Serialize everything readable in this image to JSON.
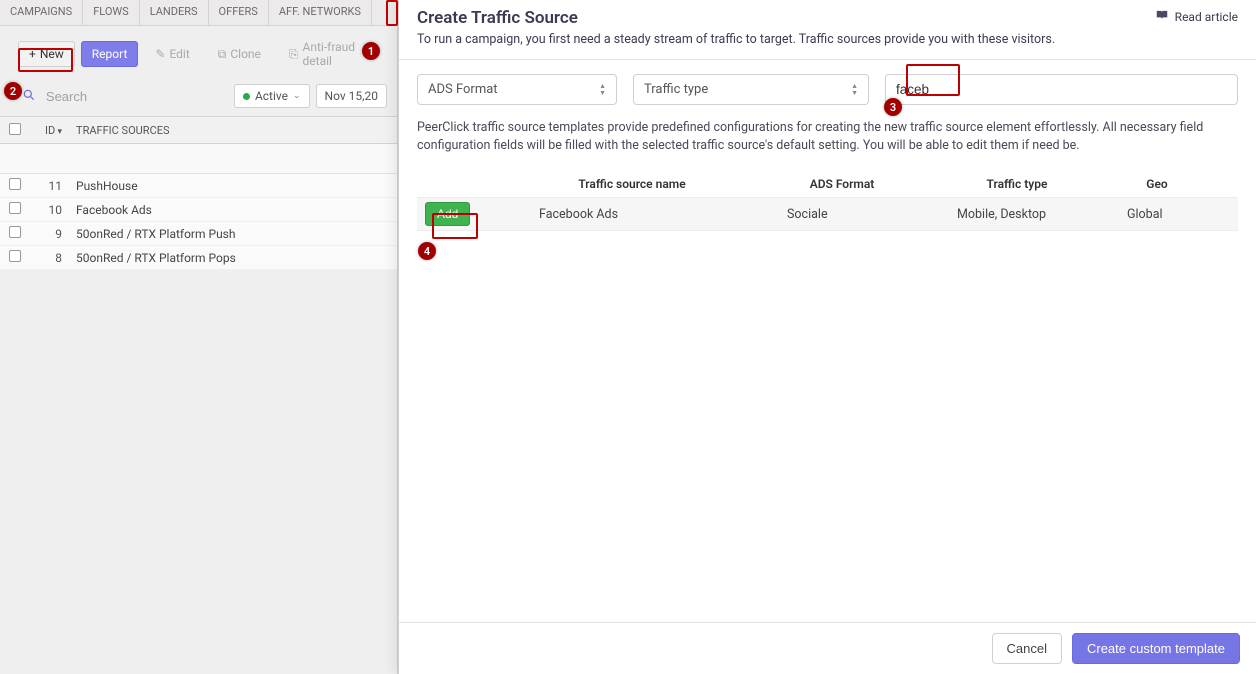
{
  "tabs": {
    "campaigns": "CAMPAIGNS",
    "flows": "FLOWS",
    "landers": "LANDERS",
    "offers": "OFFERS",
    "networks": "AFF. NETWORKS"
  },
  "toolbar": {
    "new_label": "New",
    "report_label": "Report",
    "edit_label": "Edit",
    "clone_label": "Clone",
    "antifraud_label": "Anti-fraud detail"
  },
  "search": {
    "placeholder": "Search",
    "active_label": "Active",
    "date_label": "Nov 15,20"
  },
  "table": {
    "hd_id": "ID",
    "hd_name": "TRAFFIC SOURCES",
    "rows": [
      {
        "id": "11",
        "name": "PushHouse"
      },
      {
        "id": "10",
        "name": "Facebook Ads"
      },
      {
        "id": "9",
        "name": "50onRed / RTX Platform Push"
      },
      {
        "id": "8",
        "name": "50onRed / RTX Platform Pops"
      }
    ]
  },
  "modal": {
    "title": "Create Traffic Source",
    "desc": "To run a campaign, you first need a steady stream of traffic to target. Traffic sources provide you with these visitors.",
    "read_article": "Read article",
    "sel_ads": "ADS Format",
    "sel_traffic": "Traffic type",
    "search_value": "faceb",
    "info": "PeerClick traffic source templates provide predefined configurations for creating the new traffic source element effortlessly. All necessary field configuration fields will be filled with the selected traffic source's default setting. You will be able to edit them if need be.",
    "col_name": "Traffic source name",
    "col_ads": "ADS Format",
    "col_type": "Traffic type",
    "col_geo": "Geo",
    "add_label": "Add",
    "row": {
      "name": "Facebook Ads",
      "ads": "Sociale",
      "type": "Mobile, Desktop",
      "geo": "Global"
    },
    "cancel": "Cancel",
    "create": "Create custom template"
  },
  "steps": {
    "s1": "1",
    "s2": "2",
    "s3": "3",
    "s4": "4"
  }
}
